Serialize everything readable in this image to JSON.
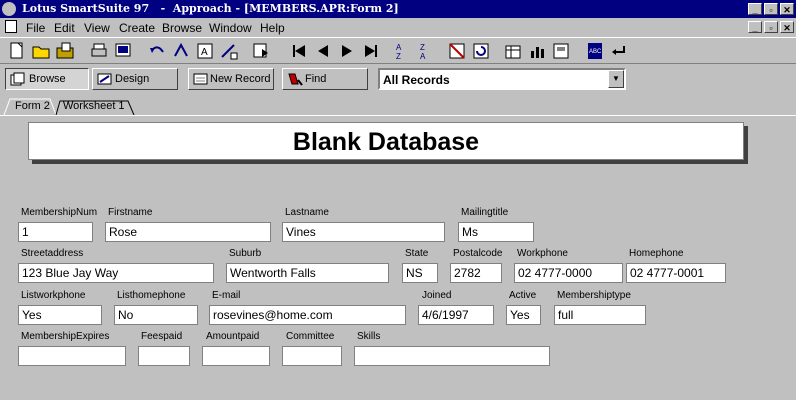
{
  "window": {
    "title": "Lotus SmartSuite 97   -  Approach - [MEMBERS.APR:Form 2]",
    "controls": {
      "minimize": "_",
      "restore": "▫",
      "close": "✕"
    }
  },
  "menu": [
    "File",
    "Edit",
    "View",
    "Create",
    "Browse",
    "Window",
    "Help"
  ],
  "toolbar_icons": [
    "new-file-icon",
    "open-folder-icon",
    "open-file-icon",
    "print-icon",
    "print-preview-icon",
    "undo-icon",
    "redo-icon",
    "find-icon",
    "replace-icon",
    "browse-copy-icon",
    "first-record-icon",
    "prev-record-icon",
    "next-record-icon",
    "last-record-icon",
    "sort-asc-icon",
    "sort-desc-icon",
    "delete-icon",
    "refresh-icon",
    "table-icon",
    "chart-icon",
    "report-icon",
    "spell-check-icon",
    "enter-icon"
  ],
  "actions": {
    "browse": "Browse",
    "design": "Design",
    "new_record": "New Record",
    "find": "Find",
    "records_select": "All Records"
  },
  "tabs": [
    "Form 2",
    "Worksheet 1"
  ],
  "form": {
    "title": "Blank Database",
    "fields": {
      "membershipnum": {
        "label": "MembershipNum",
        "value": "1"
      },
      "firstname": {
        "label": "Firstname",
        "value": "Rose"
      },
      "lastname": {
        "label": "Lastname",
        "value": "Vines"
      },
      "mailingtitle": {
        "label": "Mailingtitle",
        "value": "Ms"
      },
      "streetaddress": {
        "label": "Streetaddress",
        "value": "123 Blue Jay Way"
      },
      "suburb": {
        "label": "Suburb",
        "value": "Wentworth Falls"
      },
      "state": {
        "label": "State",
        "value": "NS"
      },
      "postalcode": {
        "label": "Postalcode",
        "value": "2782"
      },
      "workphone": {
        "label": "Workphone",
        "value": "02 4777-0000"
      },
      "homephone": {
        "label": "Homephone",
        "value": "02 4777-0001"
      },
      "listworkphone": {
        "label": "Listworkphone",
        "value": "Yes"
      },
      "listhomephone": {
        "label": "Listhomephone",
        "value": "No"
      },
      "email": {
        "label": "E-mail",
        "value": "rosevines@home.com"
      },
      "joined": {
        "label": "Joined",
        "value": "4/6/1997"
      },
      "active": {
        "label": "Active",
        "value": "Yes"
      },
      "membershiptype": {
        "label": "Membershiptype",
        "value": "full"
      },
      "membershipexpires": {
        "label": "MembershipExpires",
        "value": ""
      },
      "feespaid": {
        "label": "Feespaid",
        "value": ""
      },
      "amountpaid": {
        "label": "Amountpaid",
        "value": ""
      },
      "committee": {
        "label": "Committee",
        "value": ""
      },
      "skills": {
        "label": "Skills",
        "value": ""
      }
    }
  }
}
